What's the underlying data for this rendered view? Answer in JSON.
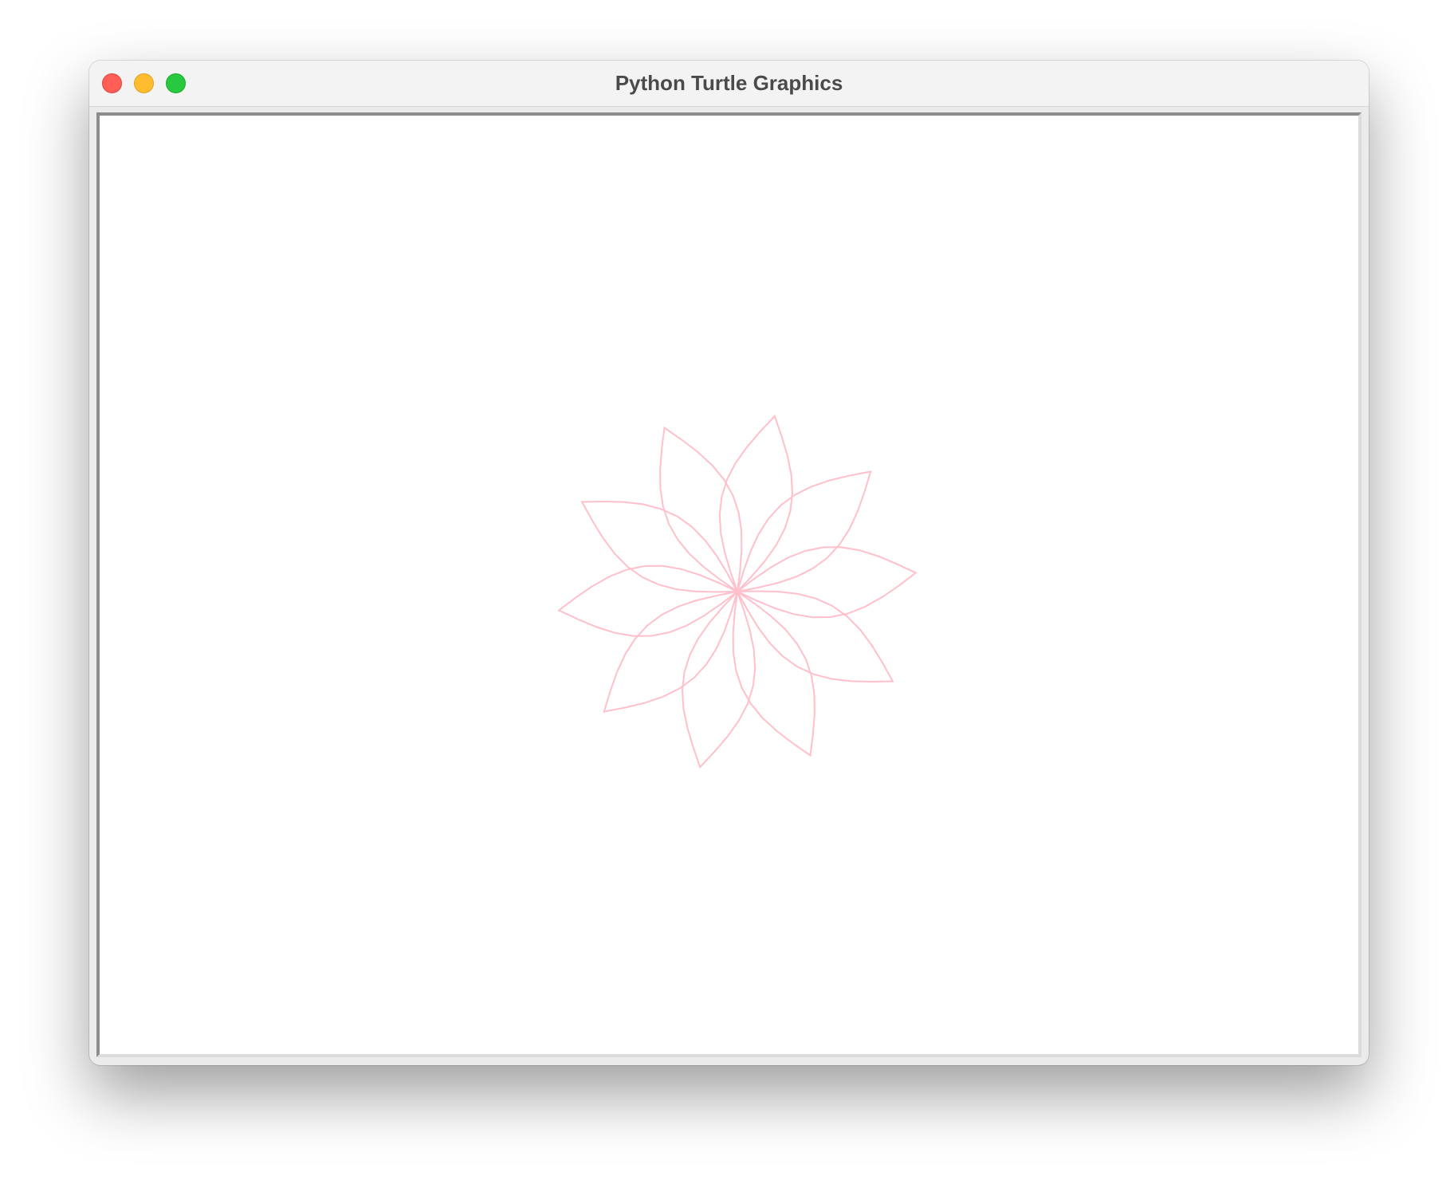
{
  "window": {
    "title": "Python Turtle Graphics"
  },
  "canvas": {
    "background": "#ffffff",
    "drawing": {
      "shape": "flower of overlapping leaf-shaped petals",
      "petal_count": 10,
      "stroke_color": "#ffc0cb"
    }
  },
  "controls": {
    "close_icon": "close-icon",
    "minimize_icon": "minimize-icon",
    "zoom_icon": "zoom-icon"
  }
}
